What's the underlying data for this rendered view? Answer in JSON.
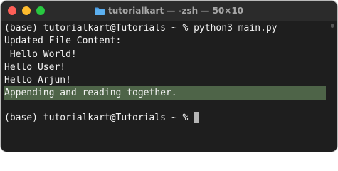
{
  "window": {
    "title": "tutorialkart — -zsh — 50×10"
  },
  "terminal": {
    "lines": [
      "(base) tutorialkart@Tutorials ~ % python3 main.py",
      "Updated File Content:",
      " Hello World!",
      "Hello User!",
      "Hello Arjun!",
      "Appending and reading together.",
      "",
      "(base) tutorialkart@Tutorials ~ % "
    ],
    "highlighted_line_index": 5
  },
  "colors": {
    "highlight": "#4e6448",
    "background": "#1e1e1e",
    "text": "#f2f2f2"
  }
}
